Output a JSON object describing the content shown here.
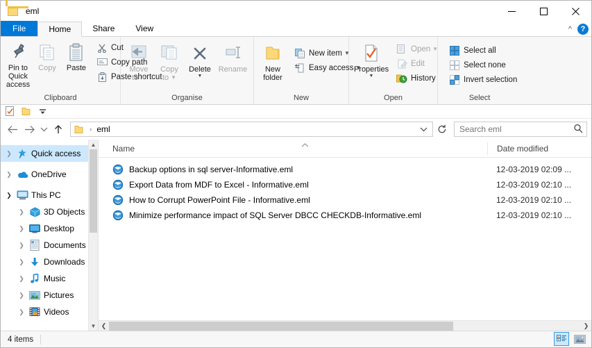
{
  "window": {
    "title": "eml",
    "folder_icon": "folder-icon",
    "minimize": "minimize-button",
    "maximize": "maximize-button",
    "close": "close-button"
  },
  "ribbon": {
    "tabs": [
      {
        "label": "File"
      },
      {
        "label": "Home"
      },
      {
        "label": "Share"
      },
      {
        "label": "View"
      }
    ],
    "collapse_icon": "chevron-up-icon",
    "help_label": "?",
    "groups": [
      {
        "label": "Clipboard",
        "big_buttons": [
          {
            "label": "Pin to Quick\naccess",
            "line1": "Pin to Quick",
            "line2": "access",
            "icon": "pin-icon"
          },
          {
            "label": "Copy",
            "line1": "Copy",
            "line2": "",
            "icon": "copy-icon"
          },
          {
            "label": "Paste",
            "line1": "Paste",
            "line2": "",
            "icon": "paste-icon"
          }
        ],
        "small_buttons": [
          {
            "label": "Cut",
            "icon": "scissors-icon"
          },
          {
            "label": "Copy path",
            "icon": "copy-path-icon"
          },
          {
            "label": "Paste shortcut",
            "icon": "paste-shortcut-icon"
          }
        ]
      },
      {
        "label": "Organise",
        "big_buttons": [
          {
            "label": "Move to",
            "line1": "Move",
            "line2": "to",
            "icon": "move-to-icon",
            "caret": true
          },
          {
            "label": "Copy to",
            "line1": "Copy",
            "line2": "to",
            "icon": "copy-to-icon",
            "caret": true
          },
          {
            "label": "Delete",
            "line1": "Delete",
            "line2": "",
            "icon": "delete-icon",
            "split": true
          },
          {
            "label": "Rename",
            "line1": "Rename",
            "line2": "",
            "icon": "rename-icon"
          }
        ],
        "small_buttons": []
      },
      {
        "label": "New",
        "big_buttons": [
          {
            "label": "New folder",
            "line1": "New",
            "line2": "folder",
            "icon": "new-folder-icon"
          }
        ],
        "small_buttons": [
          {
            "label": "New item",
            "icon": "new-item-icon",
            "caret": true
          },
          {
            "label": "Easy access",
            "icon": "easy-access-icon",
            "caret": true
          }
        ]
      },
      {
        "label": "Open",
        "big_buttons": [
          {
            "label": "Properties",
            "line1": "Properties",
            "line2": "",
            "icon": "properties-icon",
            "split": true
          }
        ],
        "small_buttons": [
          {
            "label": "Open",
            "icon": "open-icon",
            "caret": true,
            "dim": true
          },
          {
            "label": "Edit",
            "icon": "edit-icon",
            "dim": true
          },
          {
            "label": "History",
            "icon": "history-icon"
          }
        ]
      },
      {
        "label": "Select",
        "big_buttons": [],
        "small_buttons": [
          {
            "label": "Select all",
            "icon": "select-all-icon"
          },
          {
            "label": "Select none",
            "icon": "select-none-icon"
          },
          {
            "label": "Invert selection",
            "icon": "invert-selection-icon"
          }
        ]
      }
    ]
  },
  "quick_access_toolbar": {
    "items": [
      {
        "name": "properties-icon"
      },
      {
        "name": "new-folder-icon"
      },
      {
        "name": "customize-dropdown-icon"
      }
    ]
  },
  "navigation": {
    "back_icon": "back-arrow-icon",
    "forward_icon": "forward-arrow-icon",
    "recent_icon": "recent-locations-icon",
    "up_icon": "up-arrow-icon",
    "address": {
      "crumbs": [
        "eml"
      ],
      "separator": "›",
      "dropdown_icon": "chevron-down-icon"
    },
    "refresh_icon": "refresh-icon",
    "search": {
      "placeholder": "Search eml",
      "value": "",
      "icon": "search-icon"
    }
  },
  "sidebar": {
    "items": [
      {
        "label": "Quick access",
        "icon": "star-pin-icon",
        "selected": true,
        "expanded": false,
        "indent": 0
      },
      {
        "label": "OneDrive",
        "icon": "onedrive-cloud-icon",
        "selected": false,
        "expanded": false,
        "indent": 0
      },
      {
        "label": "This PC",
        "icon": "this-pc-icon",
        "selected": false,
        "expanded": true,
        "indent": 0
      },
      {
        "label": "3D Objects",
        "icon": "3d-objects-icon",
        "selected": false,
        "expanded": false,
        "indent": 1
      },
      {
        "label": "Desktop",
        "icon": "desktop-icon",
        "selected": false,
        "expanded": false,
        "indent": 1
      },
      {
        "label": "Documents",
        "icon": "documents-icon",
        "selected": false,
        "expanded": false,
        "indent": 1
      },
      {
        "label": "Downloads",
        "icon": "downloads-icon",
        "selected": false,
        "expanded": false,
        "indent": 1
      },
      {
        "label": "Music",
        "icon": "music-icon",
        "selected": false,
        "expanded": false,
        "indent": 1
      },
      {
        "label": "Pictures",
        "icon": "pictures-icon",
        "selected": false,
        "expanded": false,
        "indent": 1
      },
      {
        "label": "Videos",
        "icon": "videos-icon",
        "selected": false,
        "expanded": false,
        "indent": 1
      }
    ]
  },
  "file_list": {
    "columns": [
      {
        "label": "Name",
        "sorted": "ascending"
      },
      {
        "label": "Date modified",
        "sorted": ""
      }
    ],
    "rows": [
      {
        "name": "Backup options in sql server-Informative.eml",
        "date": "12-03-2019 02:09 ...",
        "icon": "eml-file-icon"
      },
      {
        "name": "Export Data from MDF to Excel - Informative.eml",
        "date": "12-03-2019 02:10 ...",
        "icon": "eml-file-icon"
      },
      {
        "name": "How to Corrupt PowerPoint File - Informative.eml",
        "date": "12-03-2019 02:10 ...",
        "icon": "eml-file-icon"
      },
      {
        "name": "Minimize performance impact of SQL Server DBCC CHECKDB-Informative.eml",
        "date": "12-03-2019 02:10 ...",
        "icon": "eml-file-icon"
      }
    ]
  },
  "status_bar": {
    "item_count": "4 items",
    "view_buttons": [
      {
        "name": "details-view-button",
        "selected": true
      },
      {
        "name": "large-icons-view-button",
        "selected": false
      }
    ]
  },
  "colors": {
    "accent": "#0078d7",
    "selection": "#cce8ff",
    "ribbon_bg": "#f7f7f7",
    "folder_yellow": "#fcd878"
  }
}
